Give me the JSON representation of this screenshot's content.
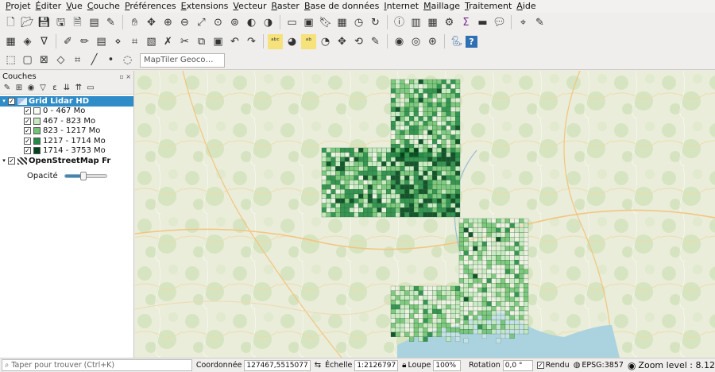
{
  "menu": [
    {
      "u": "P",
      "rest": "rojet"
    },
    {
      "u": "É",
      "rest": "diter"
    },
    {
      "u": "V",
      "rest": "ue"
    },
    {
      "u": "C",
      "rest": "ouche"
    },
    {
      "u": "P",
      "rest": "références"
    },
    {
      "u": "E",
      "rest": "xtensions"
    },
    {
      "u": "V",
      "rest": "ecteur"
    },
    {
      "u": "R",
      "rest": "aster"
    },
    {
      "u": "B",
      "rest": "ase de données"
    },
    {
      "u": "I",
      "rest": "nternet"
    },
    {
      "u": "M",
      "rest": "aillage"
    },
    {
      "u": "T",
      "rest": "raitement"
    },
    {
      "u": "A",
      "rest": "ide"
    }
  ],
  "toolbar1_icons": [
    "new-project-icon",
    "open-project-icon",
    "save-project-icon",
    "save-as-icon",
    "print-layout-icon",
    "layout-manager-icon",
    "style-manager-icon",
    "pan-icon",
    "pan-to-selection-icon",
    "zoom-in-icon",
    "zoom-out-icon",
    "zoom-full-icon",
    "zoom-to-selection-icon",
    "zoom-to-layer-icon",
    "zoom-last-icon",
    "zoom-next-icon",
    "new-map-view-icon",
    "new-3d-view-icon",
    "new-bookmark-icon",
    "show-bookmarks-icon",
    "temporal-controller-icon",
    "refresh-icon",
    "identify-icon",
    "attribute-table-icon",
    "field-calculator-icon",
    "processing-toolbox-icon",
    "statistics-icon",
    "measure-icon",
    "map-tips-icon",
    "locator-icon",
    "annotation-icon"
  ],
  "toolbar2_icons": [
    "datasource-manager-icon",
    "new-layer-icon",
    "virtual-layer-icon",
    "digitize-icon",
    "edit-pencil-icon",
    "save-edits-icon",
    "add-point-icon",
    "vertex-tool-icon",
    "modify-attributes-icon",
    "delete-selected-icon",
    "cut-features-icon",
    "copy-features-icon",
    "paste-features-icon",
    "undo-icon",
    "redo-icon",
    "label-abc-icon",
    "layer-diagram-icon",
    "label-pin-icon",
    "label-show-hide-icon",
    "label-move-icon",
    "label-rotate-icon",
    "label-change-icon",
    "plugin-web-icon",
    "quickmapservices-icon",
    "osm-search-icon",
    "python-icon",
    "help-icon"
  ],
  "toolbar3_icons": [
    "select-features-icon",
    "select-by-value-icon",
    "deselect-icon",
    "select-location-icon",
    "toggle-editing-icon",
    "digitize-line-icon",
    "digitize-point-icon",
    "locator-globe-icon"
  ],
  "geocoder_placeholder": "MapTiler Geoco…",
  "layers_panel": {
    "title": "Couches",
    "header_controls": "▫ ×",
    "tool_icons": [
      "open-layer-styling-icon",
      "add-group-icon",
      "manage-visibility-icon",
      "filter-legend-icon",
      "filter-expression-icon",
      "expand-all-icon",
      "collapse-all-icon",
      "remove-layer-icon"
    ],
    "layers": [
      {
        "name": "Grid Lidar HD",
        "checked": true,
        "expanded": true,
        "selected": true,
        "classes": [
          {
            "label": "0 - 467 Mo",
            "color": "#f7fcf5",
            "checked": true
          },
          {
            "label": "467 - 823 Mo",
            "color": "#c7e9c0",
            "checked": true
          },
          {
            "label": "823 - 1217 Mo",
            "color": "#74c476",
            "checked": true
          },
          {
            "label": "1217 - 1714 Mo",
            "color": "#238b45",
            "checked": true
          },
          {
            "label": "1714 - 3753 Mo",
            "color": "#00441b",
            "checked": true
          }
        ]
      },
      {
        "name": "OpenStreetMap Fr",
        "checked": true,
        "expanded": true,
        "selected": false
      }
    ],
    "opacity_label": "Opacité",
    "opacity_value": 0.45
  },
  "statusbar": {
    "locator_placeholder": "Taper pour trouver (Ctrl+K)",
    "coord_label": "Coordonnée",
    "coord_value": "127467,5515077",
    "scale_label": "Échelle",
    "scale_value": "1:2126797",
    "magnifier_label": "Loupe",
    "magnifier_value": "100%",
    "rotation_label": "Rotation",
    "rotation_value": "0,0 °",
    "render_label": "Rendu",
    "render_checked": true,
    "crs": "EPSG:3857",
    "zoom_text": "Zoom level : 8.12"
  },
  "colors": {
    "selection": "#308cc6",
    "grid_classes": [
      "#f7fcf5",
      "#c7e9c0",
      "#74c476",
      "#238b45",
      "#00441b"
    ]
  }
}
